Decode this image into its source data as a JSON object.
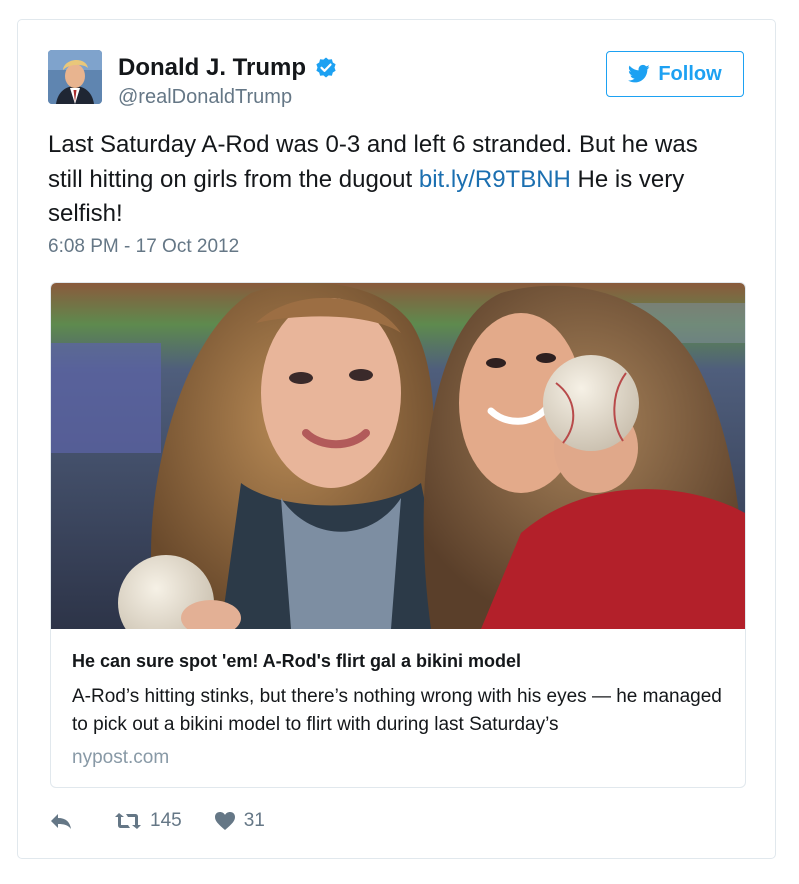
{
  "author": {
    "name": "Donald J. Trump",
    "handle": "@realDonaldTrump",
    "verified": true
  },
  "follow_button": {
    "label": "Follow",
    "icon": "twitter-bird-icon"
  },
  "tweet": {
    "text_before_link": "Last Saturday A-Rod was 0-3 and left 6 stranded. But he was still hitting on girls from the dugout ",
    "link": "bit.ly/R9TBNH",
    "text_after_link": " He is very selfish!",
    "timestamp": "6:08 PM - 17 Oct 2012"
  },
  "card": {
    "title": "He can sure spot 'em! A-Rod's flirt gal a bikini model",
    "description": "A-Rod’s hitting stinks, but there’s nothing wrong with his eyes — he managed to pick out a bikini model to flirt with during last Saturday’s",
    "domain": "nypost.com"
  },
  "actions": {
    "reply_icon": "reply-icon",
    "retweet_count": "145",
    "like_count": "31"
  },
  "colors": {
    "accent": "#1da1f2",
    "link": "#1b6fb0",
    "secondary_text": "#657786",
    "border": "#e1e8ed"
  }
}
